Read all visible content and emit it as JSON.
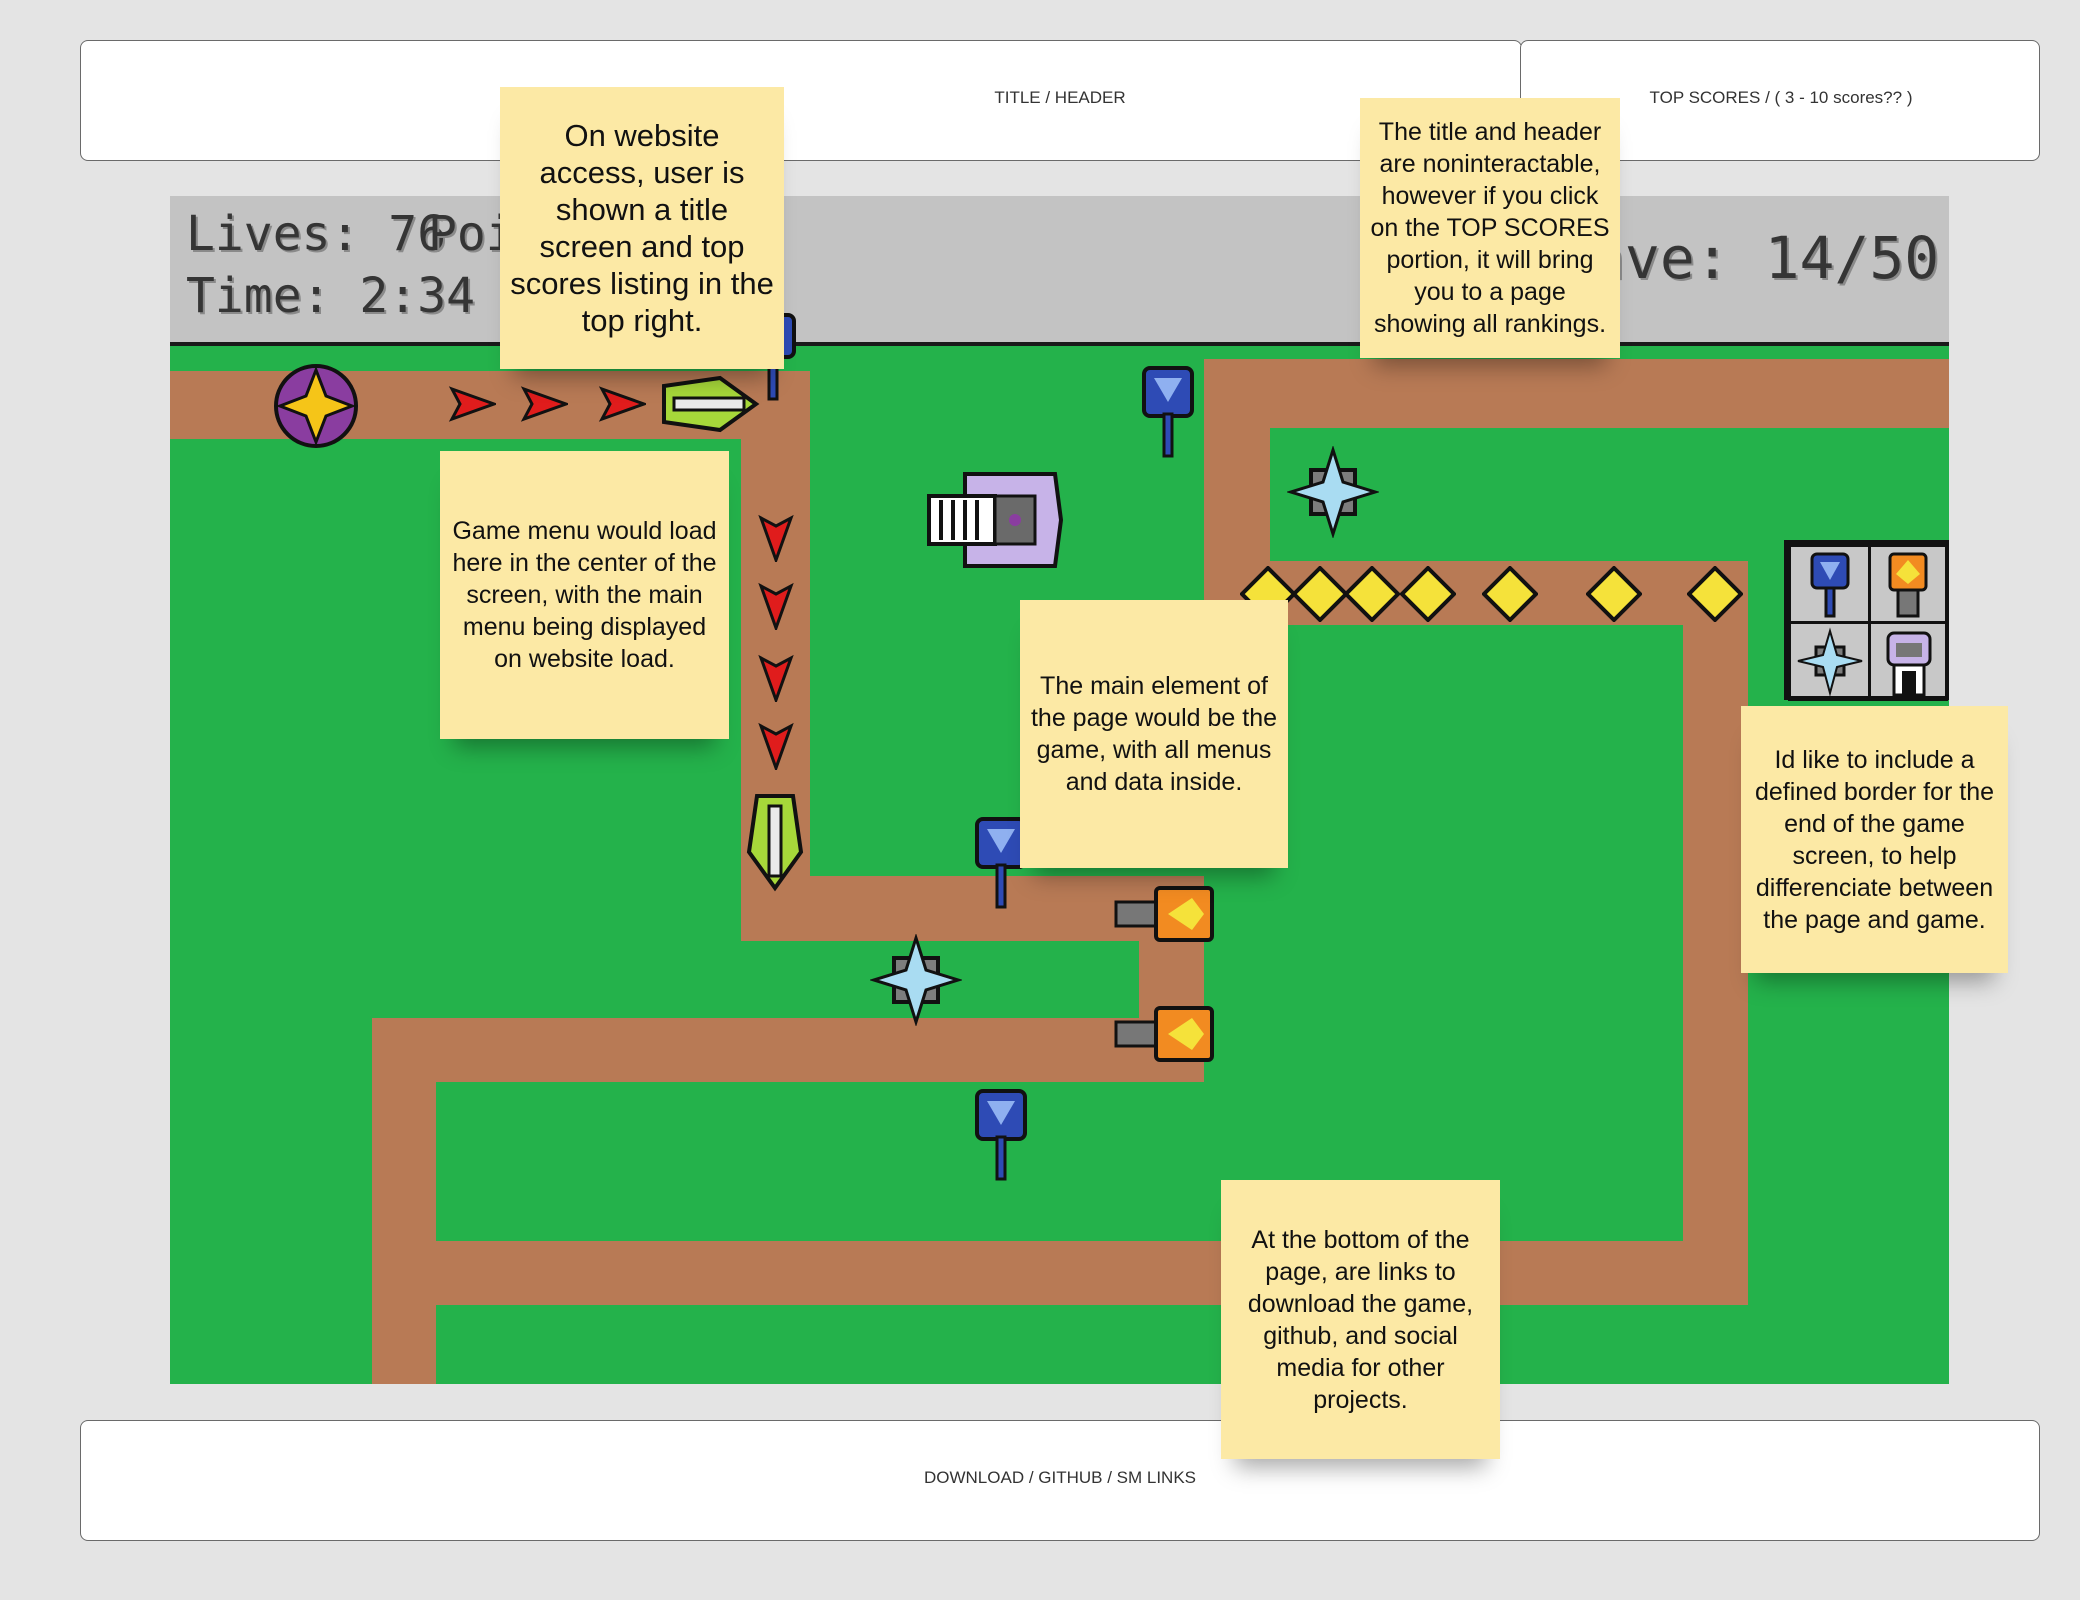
{
  "header": {
    "title_label": "TITLE / HEADER",
    "top_scores_label": "TOP SCORES / ( 3 - 10 scores?? )"
  },
  "game": {
    "hud": {
      "lives": "Lives: 76",
      "points_partial": "Poi",
      "time": "Time: 2:34",
      "wave_partial": "ave: 14/50"
    },
    "colors": {
      "grass": "#24b24b",
      "path": "#b87a55",
      "hud_bar": "#c3c3c3"
    },
    "shop_towers": [
      "blue-cannon-icon",
      "orange-flame-icon",
      "ice-crystal-icon",
      "robot-icon"
    ]
  },
  "notes": {
    "title_screen": "On website access, user is shown a title screen and top scores listing in the top right.",
    "header_interaction": "The title and header are noninteractable, however if you click on the TOP SCORES portion, it will bring you to a page showing all rankings.",
    "game_menu": "Game menu would load here in the center of the screen, with the main menu being displayed on website load.",
    "main_element": "The main element of the page would be the game, with all menus and data inside.",
    "border": "Id like to include a defined border for the end of the game screen, to help differenciate between the page and game.",
    "footer": "At the bottom of the page, are links to download the game, github, and social media for other projects."
  },
  "footer": {
    "links_label": "DOWNLOAD / GITHUB / SM LINKS"
  }
}
